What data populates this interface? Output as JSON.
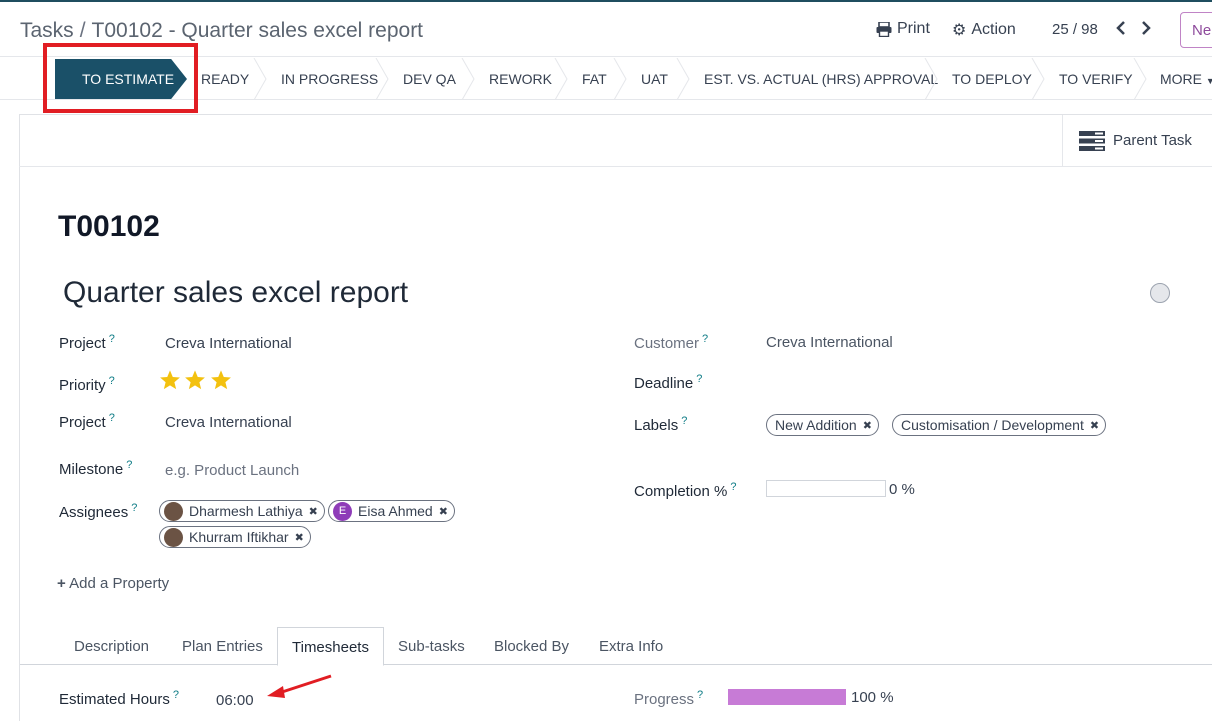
{
  "breadcrumb": {
    "parent": "Tasks",
    "separator": "/",
    "current": "T00102 - Quarter sales excel report"
  },
  "toolbar": {
    "print": "Print",
    "action": "Action",
    "pager": "25 / 98",
    "new_label": "Ne"
  },
  "stages": {
    "active": "TO ESTIMATE",
    "items": [
      "READY",
      "IN PROGRESS",
      "DEV QA",
      "REWORK",
      "FAT",
      "UAT",
      "EST. VS. ACTUAL (HRS) APPROVAL",
      "TO DEPLOY",
      "TO VERIFY"
    ],
    "more": "MORE"
  },
  "button_box": {
    "parent_task": "Parent Task"
  },
  "task": {
    "ref": "T00102",
    "name": "Quarter sales excel report",
    "fields": {
      "project_label": "Project",
      "project_value": "Creva International",
      "priority_label": "Priority",
      "priority_stars": 3,
      "project2_label": "Project",
      "project2_value": "Creva International",
      "milestone_label": "Milestone",
      "milestone_placeholder": "e.g. Product Launch",
      "assignees_label": "Assignees",
      "assignees": [
        "Dharmesh Lathiya",
        "Eisa Ahmed",
        "Khurram Iftikhar"
      ],
      "eisa_initial": "E",
      "customer_label": "Customer",
      "customer_value": "Creva International",
      "deadline_label": "Deadline",
      "labels_label": "Labels",
      "labels": [
        "New Addition",
        "Customisation / Development"
      ],
      "completion_label": "Completion %",
      "completion_value": "0 %",
      "completion_fraction": 0
    },
    "help_mark": "?",
    "add_property": "Add a Property"
  },
  "tabs": [
    "Description",
    "Plan Entries",
    "Timesheets",
    "Sub-tasks",
    "Blocked By",
    "Extra Info"
  ],
  "active_tab": "Timesheets",
  "timesheets": {
    "estimated_label": "Estimated Hours",
    "estimated_value": "06:00",
    "progress_label": "Progress",
    "progress_value": "100 %",
    "progress_fraction": 1.0
  },
  "colors": {
    "active_stage": "#1a5068",
    "highlight": "#e11d23",
    "progress": "#c77bd6",
    "star": "#f3c10f"
  }
}
